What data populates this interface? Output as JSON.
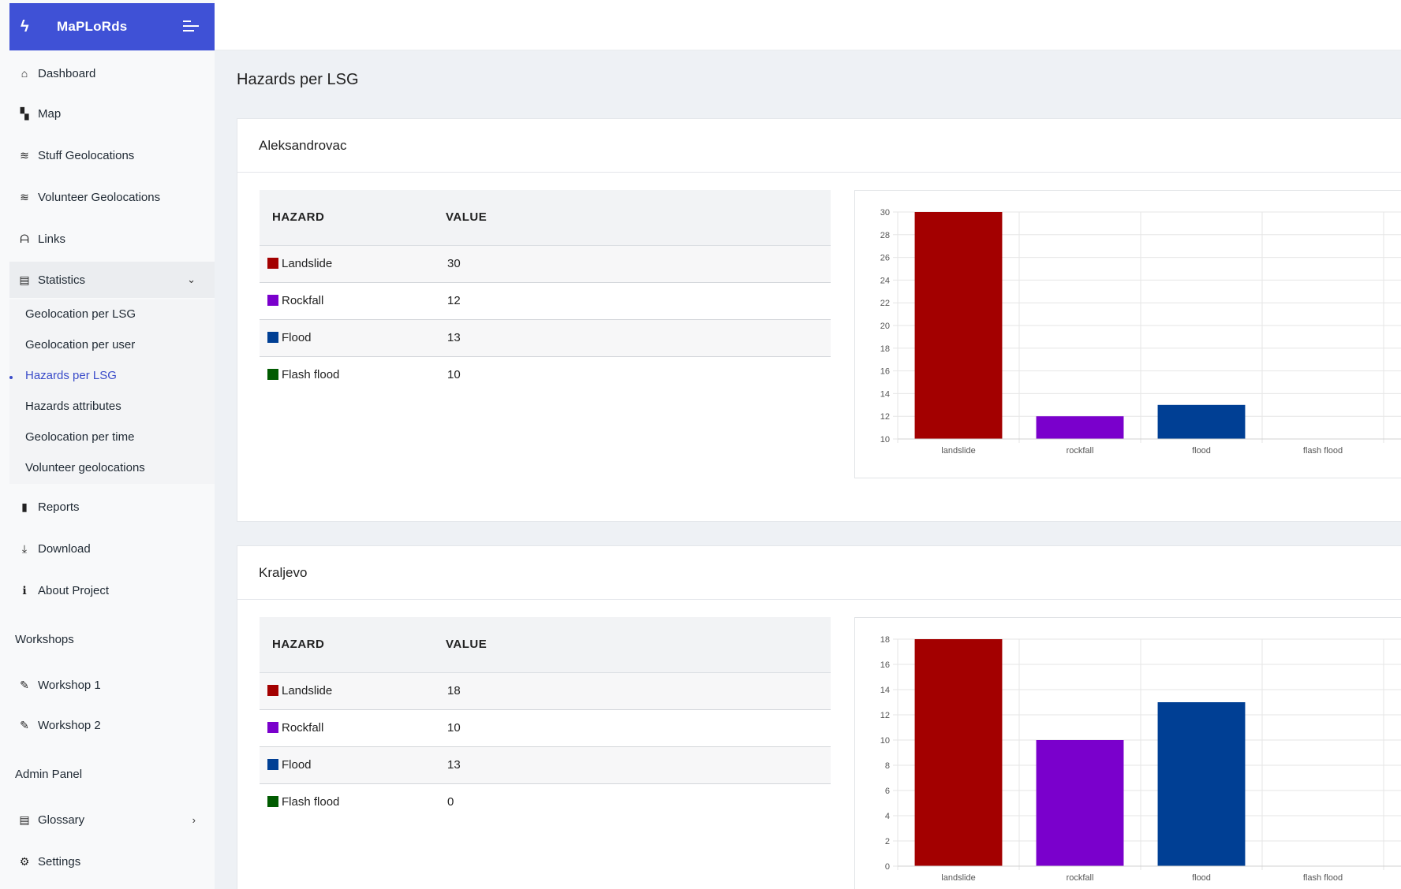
{
  "brand": {
    "name": "MaPLoRds",
    "icon": "bolt-icon"
  },
  "sidebar": {
    "items": [
      {
        "label": "Dashboard",
        "icon": "home-icon"
      },
      {
        "label": "Map",
        "icon": "map-icon"
      },
      {
        "label": "Stuff Geolocations",
        "icon": "layers-icon"
      },
      {
        "label": "Volunteer Geolocations",
        "icon": "layers-icon"
      },
      {
        "label": "Links",
        "icon": "binoculars-icon"
      },
      {
        "label": "Statistics",
        "icon": "book-icon"
      }
    ],
    "statistics_sub": [
      "Geolocation per LSG",
      "Geolocation per user",
      "Hazards per LSG",
      "Hazards attributes",
      "Geolocation per time",
      "Volunteer geolocations"
    ],
    "lower_items": [
      {
        "label": "Reports",
        "icon": "file-icon"
      },
      {
        "label": "Download",
        "icon": "download-icon"
      },
      {
        "label": "About Project",
        "icon": "info-icon"
      }
    ],
    "workshops_heading": "Workshops",
    "workshops": [
      {
        "label": "Workshop 1",
        "icon": "edit-icon"
      },
      {
        "label": "Workshop 2",
        "icon": "edit-icon"
      }
    ],
    "admin_heading": "Admin Panel",
    "admin_items": [
      {
        "label": "Glossary",
        "icon": "book-icon"
      },
      {
        "label": "Settings",
        "icon": "gears-icon"
      }
    ]
  },
  "page": {
    "title": "Hazards per LSG"
  },
  "table_headers": {
    "hazard": "HAZARD",
    "value": "VALUE"
  },
  "colors": {
    "landslide": "#a30000",
    "rockfall": "#7a00cc",
    "flood": "#003f94",
    "flash_flood": "#005b00",
    "accent": "#3f51d6"
  },
  "cards": [
    {
      "title": "Aleksandrovac",
      "rows": [
        {
          "hazard": "Landslide",
          "value": "30"
        },
        {
          "hazard": "Rockfall",
          "value": "12"
        },
        {
          "hazard": "Flood",
          "value": "13"
        },
        {
          "hazard": "Flash flood",
          "value": "10"
        }
      ]
    },
    {
      "title": "Kraljevo",
      "rows": [
        {
          "hazard": "Landslide",
          "value": "18"
        },
        {
          "hazard": "Rockfall",
          "value": "10"
        },
        {
          "hazard": "Flood",
          "value": "13"
        },
        {
          "hazard": "Flash flood",
          "value": "0"
        }
      ]
    }
  ],
  "chart_data": [
    {
      "type": "bar",
      "categories": [
        "landslide",
        "rockfall",
        "flood",
        "flash flood"
      ],
      "values": [
        30,
        12,
        13,
        10
      ],
      "colors": [
        "#a30000",
        "#7a00cc",
        "#003f94",
        "#005b00"
      ],
      "ylim": [
        10,
        30
      ],
      "yticks": [
        10,
        12,
        14,
        16,
        18,
        20,
        22,
        24,
        26,
        28,
        30
      ],
      "grid": true
    },
    {
      "type": "bar",
      "categories": [
        "landslide",
        "rockfall",
        "flood",
        "flash flood"
      ],
      "values": [
        18,
        10,
        13,
        0
      ],
      "colors": [
        "#a30000",
        "#7a00cc",
        "#003f94",
        "#005b00"
      ],
      "ylim": [
        0,
        18
      ],
      "yticks": [
        0,
        2,
        4,
        6,
        8,
        10,
        12,
        14,
        16,
        18
      ],
      "grid": true
    }
  ]
}
